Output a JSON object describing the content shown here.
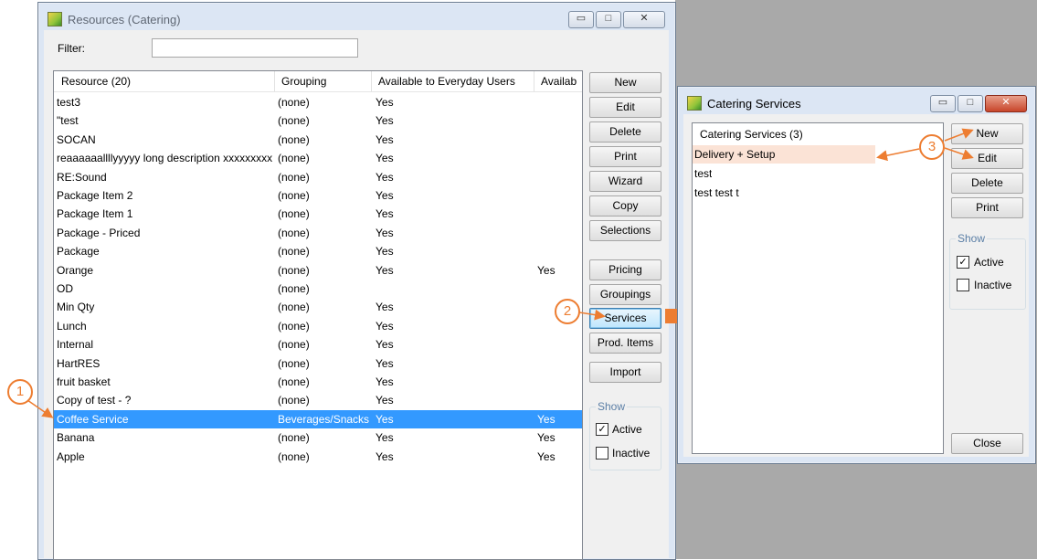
{
  "win1": {
    "title": "Resources (Catering)",
    "filter_label": "Filter:",
    "filter_value": "",
    "columns": [
      "Resource (20)",
      "Grouping",
      "Available to Everyday Users",
      "Availab"
    ],
    "rows": [
      [
        "test3",
        "(none)",
        "Yes",
        ""
      ],
      [
        "\"test",
        "(none)",
        "Yes",
        ""
      ],
      [
        "SOCAN",
        "(none)",
        "Yes",
        ""
      ],
      [
        "reaaaaaallllyyyyy long description xxxxxxxxxxxxx",
        "(none)",
        "Yes",
        ""
      ],
      [
        "RE:Sound",
        "(none)",
        "Yes",
        ""
      ],
      [
        "Package Item 2",
        "(none)",
        "Yes",
        ""
      ],
      [
        "Package Item 1",
        "(none)",
        "Yes",
        ""
      ],
      [
        "Package - Priced",
        "(none)",
        "Yes",
        ""
      ],
      [
        "Package",
        "(none)",
        "Yes",
        ""
      ],
      [
        "Orange",
        "(none)",
        "Yes",
        "Yes"
      ],
      [
        "OD",
        "(none)",
        "",
        ""
      ],
      [
        "Min Qty",
        "(none)",
        "Yes",
        ""
      ],
      [
        "Lunch",
        "(none)",
        "Yes",
        ""
      ],
      [
        "Internal",
        "(none)",
        "Yes",
        ""
      ],
      [
        "HartRES",
        "(none)",
        "Yes",
        ""
      ],
      [
        "fruit basket",
        "(none)",
        "Yes",
        ""
      ],
      [
        "Copy of test - ?",
        "(none)",
        "Yes",
        ""
      ],
      [
        "Coffee Service",
        "Beverages/Snacks",
        "Yes",
        "Yes"
      ],
      [
        "Banana",
        "(none)",
        "Yes",
        "Yes"
      ],
      [
        "Apple",
        "(none)",
        "Yes",
        "Yes"
      ]
    ],
    "selected_row": "Coffee Service",
    "buttons": {
      "new": "New",
      "edit": "Edit",
      "delete": "Delete",
      "print": "Print",
      "wizard": "Wizard",
      "copy": "Copy",
      "selections": "Selections",
      "pricing": "Pricing",
      "groupings": "Groupings",
      "services": "Services",
      "prod_items": "Prod. Items",
      "import": "Import"
    },
    "show": {
      "label": "Show",
      "active": "Active",
      "inactive": "Inactive",
      "active_checked": true,
      "inactive_checked": false
    }
  },
  "win2": {
    "title": "Catering Services",
    "header": "Catering Services (3)",
    "items": [
      "Delivery + Setup",
      "test",
      "test test t"
    ],
    "highlighted_item": "Delivery + Setup",
    "buttons": {
      "new": "New",
      "edit": "Edit",
      "delete": "Delete",
      "print": "Print",
      "close": "Close"
    },
    "show": {
      "label": "Show",
      "active": "Active",
      "inactive": "Inactive",
      "active_checked": true,
      "inactive_checked": false
    }
  },
  "callouts": [
    "1",
    "2",
    "3"
  ],
  "colors": {
    "accent": "#ed7d31",
    "selection": "#3399ff",
    "highlight": "#fbe3d6"
  }
}
